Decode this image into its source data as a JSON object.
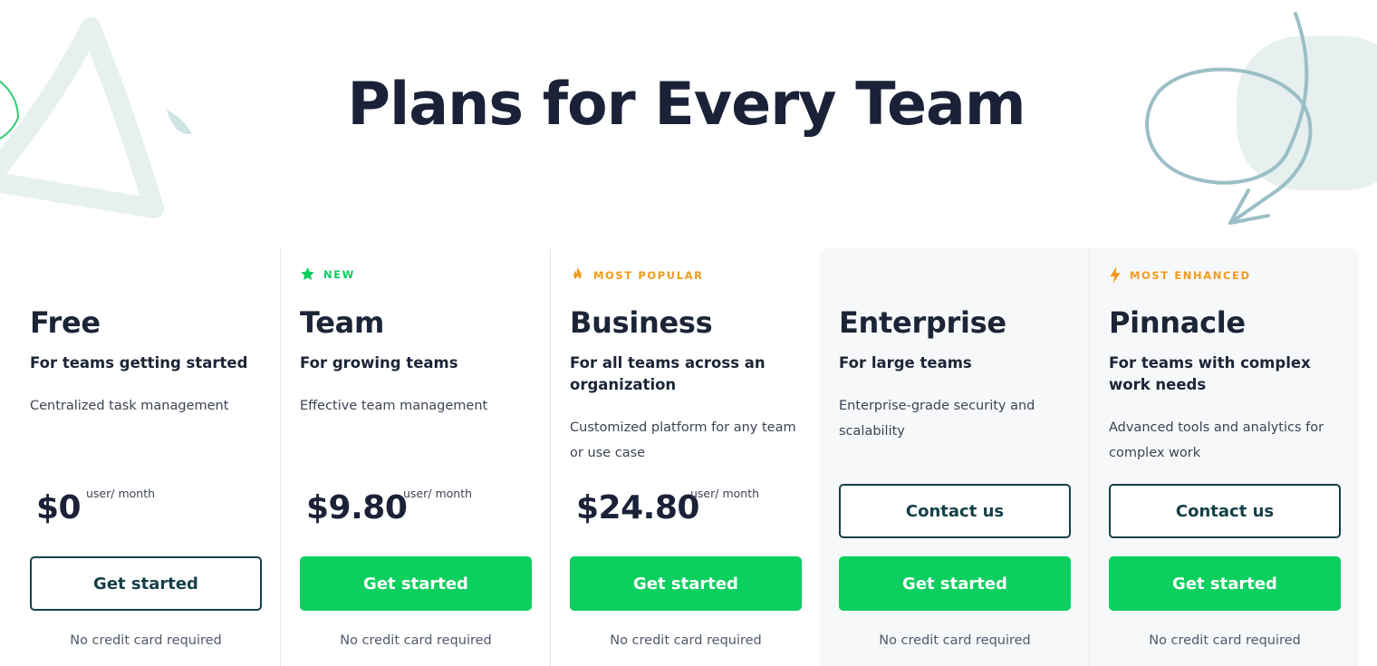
{
  "page": {
    "title": "Plans for Every Team"
  },
  "colors": {
    "accent_green": "#0bcf5e",
    "badge_orange": "#f39a1b",
    "navy": "#1b2238",
    "outline_teal": "#153f48"
  },
  "plans": [
    {
      "badge": null,
      "name": "Free",
      "subtitle": "For teams getting started",
      "description": "Centralized task management",
      "price": "$0",
      "price_unit": "user/ month",
      "contact_label": null,
      "cta_label": "Get started",
      "cta_style": "outline",
      "note": "No credit card required"
    },
    {
      "badge": {
        "label": "NEW",
        "icon": "star-icon",
        "color": "#0bcf5e"
      },
      "name": "Team",
      "subtitle": "For growing teams",
      "description": "Effective team management",
      "price": "$9.80",
      "price_unit": "user/ month",
      "contact_label": null,
      "cta_label": "Get started",
      "cta_style": "solid",
      "note": "No credit card required"
    },
    {
      "badge": {
        "label": "MOST POPULAR",
        "icon": "flame-icon",
        "color": "#f39a1b"
      },
      "name": "Business",
      "subtitle": "For all teams across an organization",
      "description": "Customized platform for any team or use case",
      "price": "$24.80",
      "price_unit": "user/ month",
      "contact_label": null,
      "cta_label": "Get started",
      "cta_style": "solid",
      "note": "No credit card required"
    },
    {
      "badge": null,
      "name": "Enterprise",
      "subtitle": "For large teams",
      "description": "Enterprise-grade security and scalability",
      "price": null,
      "price_unit": null,
      "contact_label": "Contact us",
      "cta_label": "Get started",
      "cta_style": "solid",
      "note": "No credit card required"
    },
    {
      "badge": {
        "label": "MOST ENHANCED",
        "icon": "lightning-icon",
        "color": "#f39a1b"
      },
      "name": "Pinnacle",
      "subtitle": "For teams with complex work needs",
      "description": "Advanced tools and analytics for complex work",
      "price": null,
      "price_unit": null,
      "contact_label": "Contact us",
      "cta_label": "Get started",
      "cta_style": "solid",
      "note": "No credit card required"
    }
  ]
}
